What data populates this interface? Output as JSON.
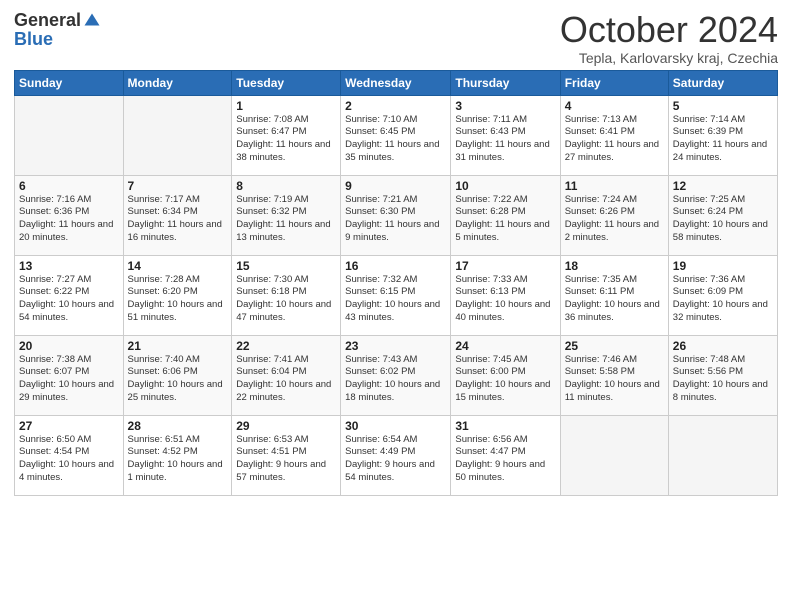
{
  "logo": {
    "general": "General",
    "blue": "Blue"
  },
  "title": "October 2024",
  "subtitle": "Tepla, Karlovarsky kraj, Czechia",
  "days_of_week": [
    "Sunday",
    "Monday",
    "Tuesday",
    "Wednesday",
    "Thursday",
    "Friday",
    "Saturday"
  ],
  "weeks": [
    [
      {
        "day": "",
        "info": ""
      },
      {
        "day": "",
        "info": ""
      },
      {
        "day": "1",
        "info": "Sunrise: 7:08 AM\nSunset: 6:47 PM\nDaylight: 11 hours and 38 minutes."
      },
      {
        "day": "2",
        "info": "Sunrise: 7:10 AM\nSunset: 6:45 PM\nDaylight: 11 hours and 35 minutes."
      },
      {
        "day": "3",
        "info": "Sunrise: 7:11 AM\nSunset: 6:43 PM\nDaylight: 11 hours and 31 minutes."
      },
      {
        "day": "4",
        "info": "Sunrise: 7:13 AM\nSunset: 6:41 PM\nDaylight: 11 hours and 27 minutes."
      },
      {
        "day": "5",
        "info": "Sunrise: 7:14 AM\nSunset: 6:39 PM\nDaylight: 11 hours and 24 minutes."
      }
    ],
    [
      {
        "day": "6",
        "info": "Sunrise: 7:16 AM\nSunset: 6:36 PM\nDaylight: 11 hours and 20 minutes."
      },
      {
        "day": "7",
        "info": "Sunrise: 7:17 AM\nSunset: 6:34 PM\nDaylight: 11 hours and 16 minutes."
      },
      {
        "day": "8",
        "info": "Sunrise: 7:19 AM\nSunset: 6:32 PM\nDaylight: 11 hours and 13 minutes."
      },
      {
        "day": "9",
        "info": "Sunrise: 7:21 AM\nSunset: 6:30 PM\nDaylight: 11 hours and 9 minutes."
      },
      {
        "day": "10",
        "info": "Sunrise: 7:22 AM\nSunset: 6:28 PM\nDaylight: 11 hours and 5 minutes."
      },
      {
        "day": "11",
        "info": "Sunrise: 7:24 AM\nSunset: 6:26 PM\nDaylight: 11 hours and 2 minutes."
      },
      {
        "day": "12",
        "info": "Sunrise: 7:25 AM\nSunset: 6:24 PM\nDaylight: 10 hours and 58 minutes."
      }
    ],
    [
      {
        "day": "13",
        "info": "Sunrise: 7:27 AM\nSunset: 6:22 PM\nDaylight: 10 hours and 54 minutes."
      },
      {
        "day": "14",
        "info": "Sunrise: 7:28 AM\nSunset: 6:20 PM\nDaylight: 10 hours and 51 minutes."
      },
      {
        "day": "15",
        "info": "Sunrise: 7:30 AM\nSunset: 6:18 PM\nDaylight: 10 hours and 47 minutes."
      },
      {
        "day": "16",
        "info": "Sunrise: 7:32 AM\nSunset: 6:15 PM\nDaylight: 10 hours and 43 minutes."
      },
      {
        "day": "17",
        "info": "Sunrise: 7:33 AM\nSunset: 6:13 PM\nDaylight: 10 hours and 40 minutes."
      },
      {
        "day": "18",
        "info": "Sunrise: 7:35 AM\nSunset: 6:11 PM\nDaylight: 10 hours and 36 minutes."
      },
      {
        "day": "19",
        "info": "Sunrise: 7:36 AM\nSunset: 6:09 PM\nDaylight: 10 hours and 32 minutes."
      }
    ],
    [
      {
        "day": "20",
        "info": "Sunrise: 7:38 AM\nSunset: 6:07 PM\nDaylight: 10 hours and 29 minutes."
      },
      {
        "day": "21",
        "info": "Sunrise: 7:40 AM\nSunset: 6:06 PM\nDaylight: 10 hours and 25 minutes."
      },
      {
        "day": "22",
        "info": "Sunrise: 7:41 AM\nSunset: 6:04 PM\nDaylight: 10 hours and 22 minutes."
      },
      {
        "day": "23",
        "info": "Sunrise: 7:43 AM\nSunset: 6:02 PM\nDaylight: 10 hours and 18 minutes."
      },
      {
        "day": "24",
        "info": "Sunrise: 7:45 AM\nSunset: 6:00 PM\nDaylight: 10 hours and 15 minutes."
      },
      {
        "day": "25",
        "info": "Sunrise: 7:46 AM\nSunset: 5:58 PM\nDaylight: 10 hours and 11 minutes."
      },
      {
        "day": "26",
        "info": "Sunrise: 7:48 AM\nSunset: 5:56 PM\nDaylight: 10 hours and 8 minutes."
      }
    ],
    [
      {
        "day": "27",
        "info": "Sunrise: 6:50 AM\nSunset: 4:54 PM\nDaylight: 10 hours and 4 minutes."
      },
      {
        "day": "28",
        "info": "Sunrise: 6:51 AM\nSunset: 4:52 PM\nDaylight: 10 hours and 1 minute."
      },
      {
        "day": "29",
        "info": "Sunrise: 6:53 AM\nSunset: 4:51 PM\nDaylight: 9 hours and 57 minutes."
      },
      {
        "day": "30",
        "info": "Sunrise: 6:54 AM\nSunset: 4:49 PM\nDaylight: 9 hours and 54 minutes."
      },
      {
        "day": "31",
        "info": "Sunrise: 6:56 AM\nSunset: 4:47 PM\nDaylight: 9 hours and 50 minutes."
      },
      {
        "day": "",
        "info": ""
      },
      {
        "day": "",
        "info": ""
      }
    ]
  ]
}
